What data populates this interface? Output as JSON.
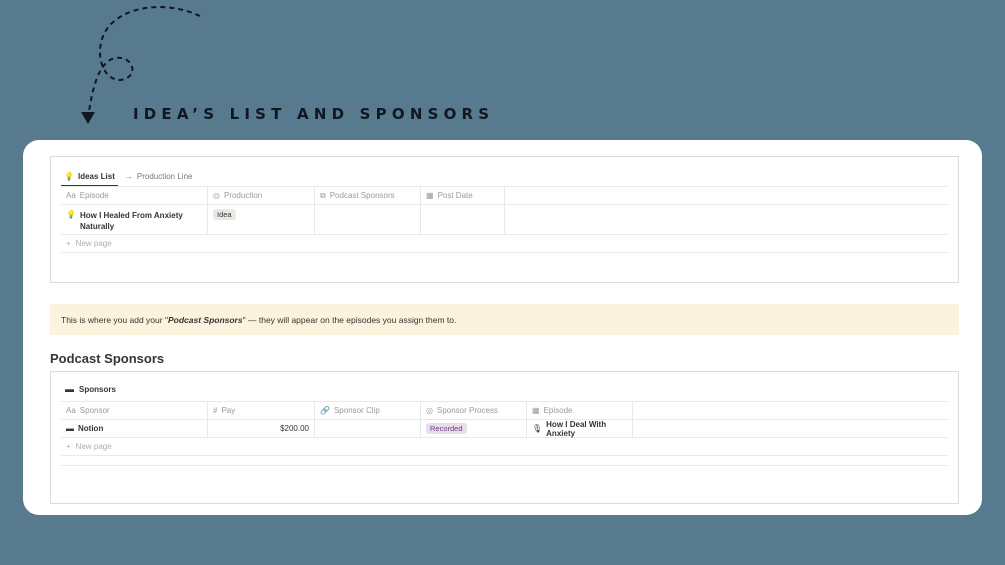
{
  "headline": "IDEA’S LIST AND SPONSORS",
  "ideas_view": {
    "tabs": [
      {
        "label": "Ideas List",
        "icon": "lightbulb-icon"
      },
      {
        "label": "Production Line",
        "icon": "arrow-right-icon"
      }
    ],
    "columns": [
      {
        "label": "Episode",
        "icon": "Aa"
      },
      {
        "label": "Production",
        "icon": "status-icon"
      },
      {
        "label": "Podcast Sponsors",
        "icon": "relation-icon"
      },
      {
        "label": "Post Date",
        "icon": "calendar-icon"
      }
    ],
    "rows": [
      {
        "episode": "How I Healed From Anxiety Naturally",
        "production": "Idea",
        "sponsors": "",
        "post_date": ""
      }
    ],
    "new_page_label": "New page"
  },
  "callout": {
    "prefix": "This is where you add your \"",
    "emphasis": "Podcast Sponsors",
    "suffix": "\" — they will appear on the episodes you assign them to."
  },
  "sponsors_section": {
    "title": "Podcast Sponsors",
    "view_label": "Sponsors",
    "columns": [
      {
        "label": "Sponsor",
        "icon": "Aa"
      },
      {
        "label": "Pay",
        "icon": "#"
      },
      {
        "label": "Sponsor Clip",
        "icon": "link-icon"
      },
      {
        "label": "Sponsor Process",
        "icon": "status-icon"
      },
      {
        "label": "Episode",
        "icon": "calendar-icon"
      }
    ],
    "rows": [
      {
        "sponsor": "Notion",
        "pay": "$200.00",
        "clip": "",
        "process": "Recorded",
        "episode": "How I Deal With Anxiety"
      }
    ],
    "new_page_label": "New page"
  },
  "colors": {
    "background": "#587a8f",
    "idea_tag": "#e9e8e5",
    "recorded_tag": "#e8deee",
    "recorded_text": "#6a3b80",
    "callout_bg": "#fbf3de"
  }
}
